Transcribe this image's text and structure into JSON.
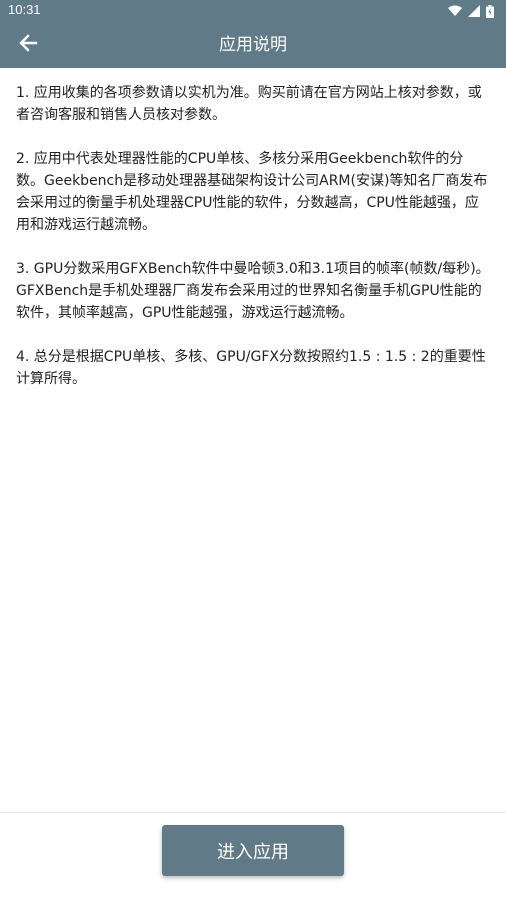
{
  "status_bar": {
    "time": "10:31"
  },
  "toolbar": {
    "title": "应用说明",
    "back_icon": "arrow-left-icon"
  },
  "content": {
    "paragraphs": [
      "1. 应用收集的各项参数请以实机为准。购买前请在官方网站上核对参数，或者咨询客服和销售人员核对参数。",
      "2. 应用中代表处理器性能的CPU单核、多核分采用Geekbench软件的分数。Geekbench是移动处理器基础架构设计公司ARM(安谋)等知名厂商发布会采用过的衡量手机处理器CPU性能的软件，分数越高，CPU性能越强，应用和游戏运行越流畅。",
      "3. GPU分数采用GFXBench软件中曼哈顿3.0和3.1项目的帧率(帧数/每秒)。GFXBench是手机处理器厂商发布会采用过的世界知名衡量手机GPU性能的软件，其帧率越高，GPU性能越强，游戏运行越流畅。",
      "4. 总分是根据CPU单核、多核、GPU/GFX分数按照约1.5 : 1.5 : 2的重要性计算所得。"
    ]
  },
  "footer": {
    "enter_button_label": "进入应用"
  },
  "colors": {
    "primary": "#607a87",
    "text": "#222222",
    "background": "#ffffff"
  }
}
